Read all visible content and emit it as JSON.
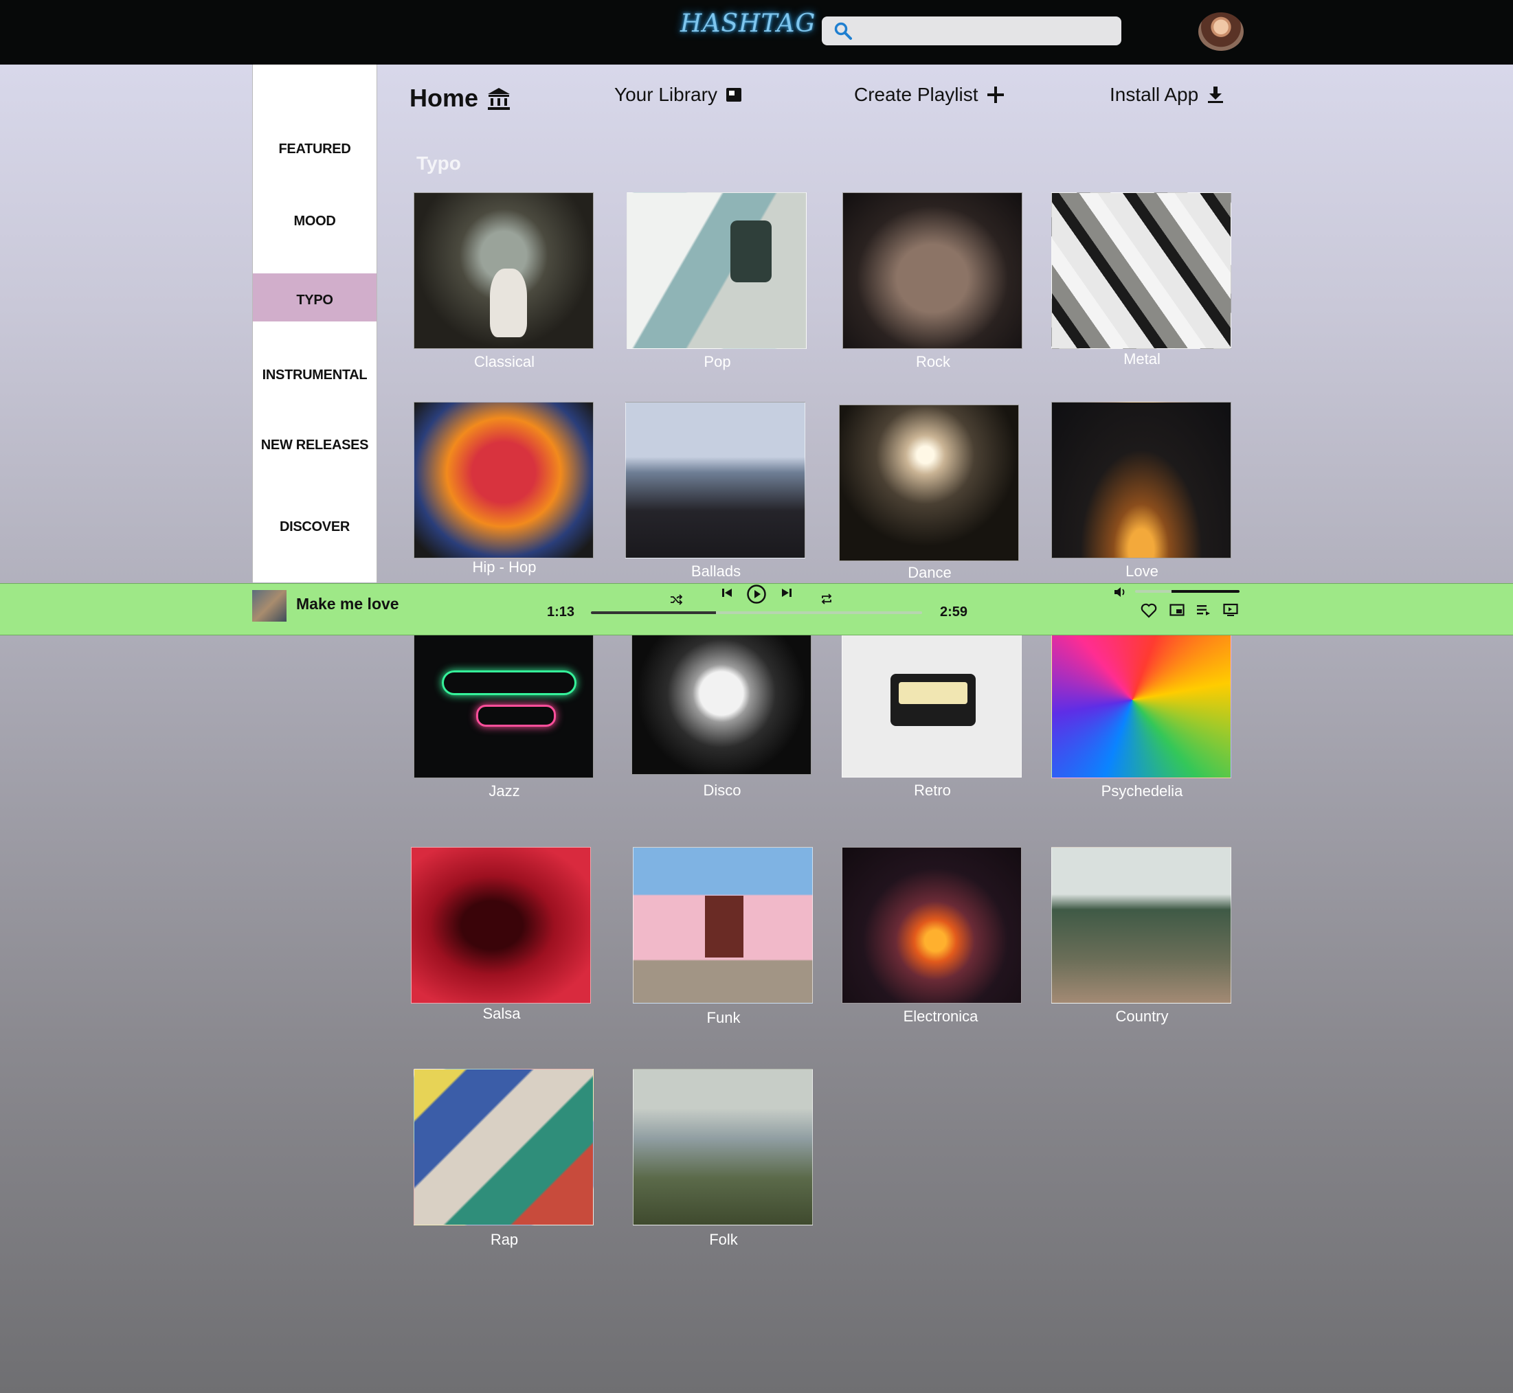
{
  "brand": {
    "logo": "HASHTAG"
  },
  "search": {
    "placeholder": ""
  },
  "nav": {
    "home": "Home",
    "library": "Your Library",
    "create": "Create Playlist",
    "install": "Install App"
  },
  "sidebar": {
    "items": [
      "FEATURED",
      "MOOD",
      "TYPO",
      "INSTRUMENTAL",
      "NEW RELEASES",
      "DISCOVER"
    ],
    "active": "TYPO",
    "active_color": "#d1aecb"
  },
  "section": {
    "title": "Typo"
  },
  "genres": [
    "Classical",
    "Pop",
    "Rock",
    "Metal",
    "Hip - Hop",
    "Ballads",
    "Dance",
    "Love",
    "Jazz",
    "Disco",
    "Retro",
    "Psychedelia",
    "Salsa",
    "Funk",
    "Electronica",
    "Country",
    "Rap",
    "Folk"
  ],
  "player": {
    "track": "Make me love",
    "elapsed": "1:13",
    "duration": "2:59",
    "progress_fraction": 0.377,
    "volume_fraction": 0.35,
    "bar_color": "#9ee887"
  }
}
